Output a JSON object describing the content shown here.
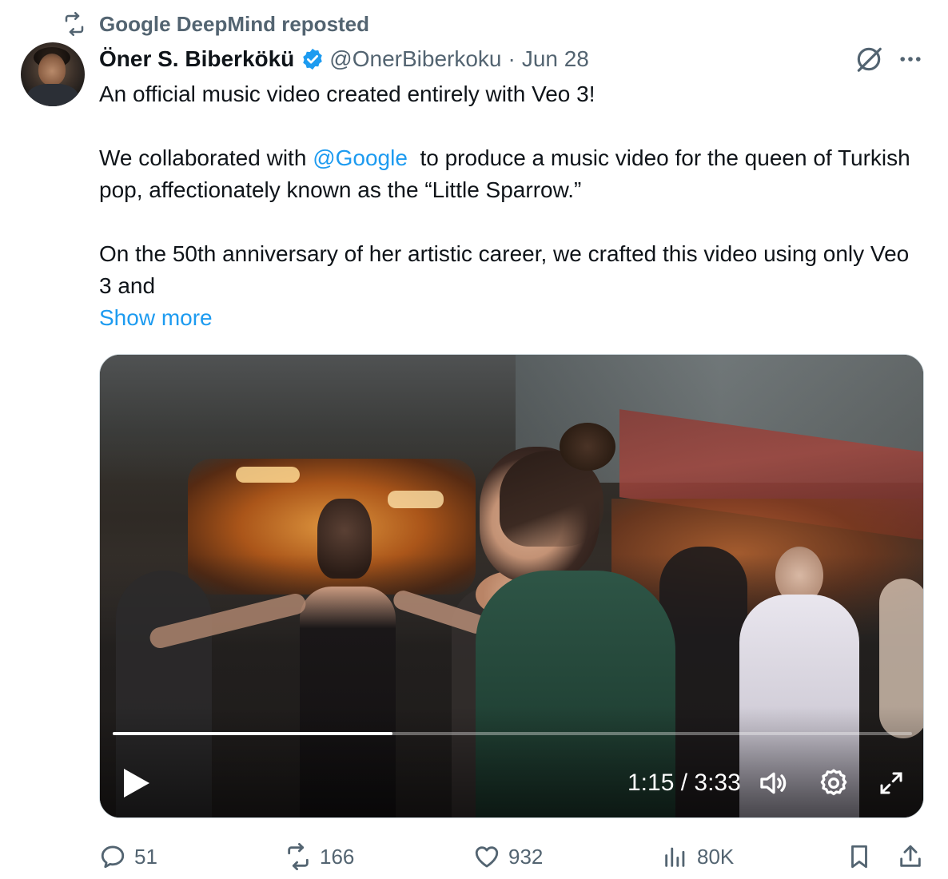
{
  "social_context": {
    "text": "Google DeepMind reposted",
    "icon": "repost-icon"
  },
  "author": {
    "name": "Öner S. Biberkökü",
    "verified": true,
    "handle": "@OnerBiberkoku",
    "separator": "·",
    "date": "Jun 28"
  },
  "tweet": {
    "line1": "An official music video created entirely with Veo 3!",
    "p2_before": "We collaborated with ",
    "p2_mention": "@Google",
    "p2_after": "  to produce a music video for the queen of Turkish pop, affectionately known as the “Little Sparrow.”",
    "p3": "On the 50th anniversary of her artistic career, we crafted this video using only Veo 3 and",
    "show_more": "Show more"
  },
  "video": {
    "time": "1:15 / 3:33",
    "progress": 0.35,
    "controls": [
      "play-icon",
      "volume-icon",
      "settings-icon",
      "fullscreen-icon"
    ]
  },
  "actions": {
    "replies": "51",
    "reposts": "166",
    "likes": "932",
    "views": "80K"
  },
  "colors": {
    "accent": "#1d9bf0",
    "secondary_text": "#536471",
    "text": "#0f1419"
  }
}
